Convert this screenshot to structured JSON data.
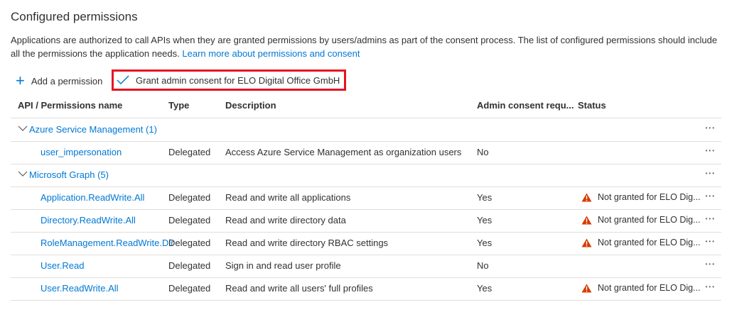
{
  "title": "Configured permissions",
  "intro": "Applications are authorized to call APIs when they are granted permissions by users/admins as part of the consent process. The list of configured permissions should include all the permissions the application needs.",
  "learn_more": "Learn more about permissions and consent",
  "toolbar": {
    "add": "Add a permission",
    "grant": "Grant admin consent for ELO Digital Office GmbH"
  },
  "columns": [
    "API / Permissions name",
    "Type",
    "Description",
    "Admin consent requ...",
    "Status"
  ],
  "colors": {
    "accent": "#0078d4",
    "warning": "#d83b01",
    "highlight": "#e81123"
  },
  "rows": [
    {
      "group": true,
      "name": "Azure Service Management (1)"
    },
    {
      "name": "user_impersonation",
      "type": "Delegated",
      "desc": "Access Azure Service Management as organization users",
      "admin": "No",
      "status": ""
    },
    {
      "group": true,
      "name": "Microsoft Graph (5)"
    },
    {
      "name": "Application.ReadWrite.All",
      "type": "Delegated",
      "desc": "Read and write all applications",
      "admin": "Yes",
      "status": "Not granted for ELO Dig..."
    },
    {
      "name": "Directory.ReadWrite.All",
      "type": "Delegated",
      "desc": "Read and write directory data",
      "admin": "Yes",
      "status": "Not granted for ELO Dig..."
    },
    {
      "name": "RoleManagement.ReadWrite.Dir",
      "type": "Delegated",
      "desc": "Read and write directory RBAC settings",
      "admin": "Yes",
      "status": "Not granted for ELO Dig..."
    },
    {
      "name": "User.Read",
      "type": "Delegated",
      "desc": "Sign in and read user profile",
      "admin": "No",
      "status": ""
    },
    {
      "name": "User.ReadWrite.All",
      "type": "Delegated",
      "desc": "Read and write all users' full profiles",
      "admin": "Yes",
      "status": "Not granted for ELO Dig..."
    }
  ]
}
